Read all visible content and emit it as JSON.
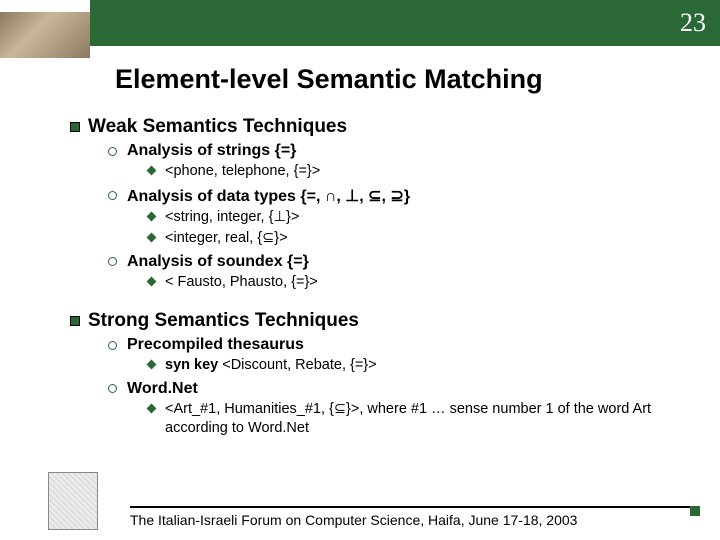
{
  "page_number": "23",
  "title": "Element-level Semantic Matching",
  "section1": {
    "heading": "Weak Semantics Techniques",
    "item1": {
      "label": "Analysis of strings {=}",
      "sub1": "<phone, telephone, {=}>"
    },
    "item2": {
      "label": "Analysis of data types {=, ∩, ⊥, ⊆, ⊇}",
      "sub1": "<string, integer, {⊥}>",
      "sub2": "<integer, real, {⊆}>"
    },
    "item3": {
      "label": "Analysis of soundex {=}",
      "sub1": "< Fausto, Phausto, {=}>"
    }
  },
  "section2": {
    "heading": "Strong Semantics Techniques",
    "item1": {
      "label": "Precompiled thesaurus",
      "sub1_prefix": "syn key",
      "sub1_rest": " <Discount, Rebate, {=}>"
    },
    "item2": {
      "label": "Word.Net",
      "sub1": "<Art_#1, Humanities_#1, {⊆}>, where #1 … sense number 1 of the word Art according to Word.Net"
    }
  },
  "footer": "The Italian-Israeli Forum on Computer Science, Haifa, June 17-18, 2003"
}
